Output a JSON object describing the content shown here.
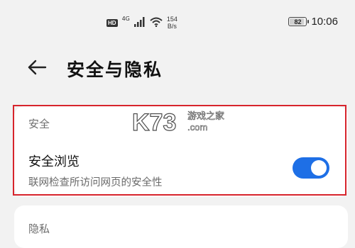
{
  "status_bar": {
    "hd": "HD",
    "network": "4G",
    "speed_value": "154",
    "speed_unit": "B/s",
    "battery_level": "82",
    "battery_fraction": 0.82,
    "time": "10:06",
    "icons": [
      "signal-icon",
      "wifi-icon",
      "battery-icon"
    ]
  },
  "header": {
    "back_icon": "arrow-left-icon",
    "title": "安全与隐私"
  },
  "security_section": {
    "header": "安全",
    "safe_browsing": {
      "title": "安全浏览",
      "subtitle": "联网检查所访问网页的安全性",
      "enabled": true
    }
  },
  "privacy_section": {
    "header": "隐私"
  },
  "watermark": {
    "logo": "K73",
    "cn": "游戏之家",
    "domain": ".com"
  },
  "colors": {
    "accent": "#1e6fe6",
    "highlight": "#d7242c",
    "background": "#f2f2f2"
  }
}
